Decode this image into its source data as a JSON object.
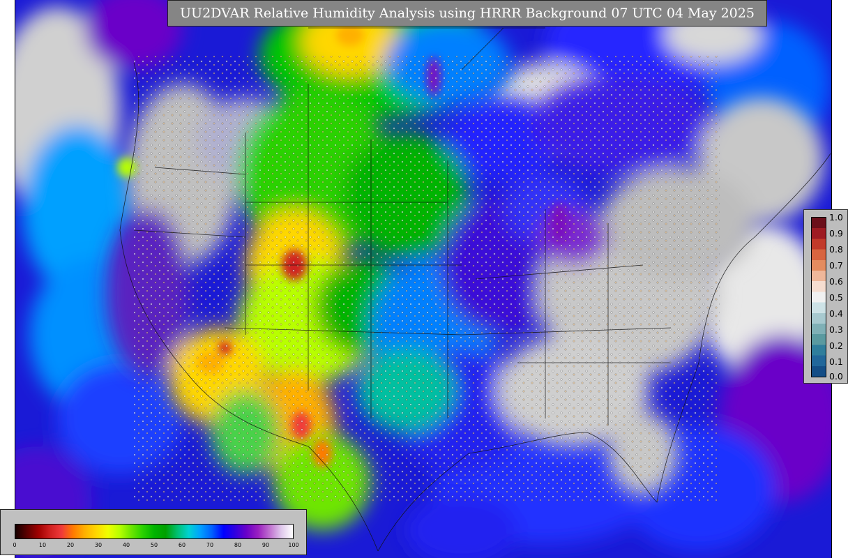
{
  "title": "UU2DVAR Relative Humidity Analysis using HRRR Background 07 UTC 04 May 2025",
  "legend_right": {
    "ticks": [
      "1.0",
      "0.9",
      "0.8",
      "0.7",
      "0.6",
      "0.5",
      "0.4",
      "0.3",
      "0.2",
      "0.1",
      "0.0"
    ],
    "colors": [
      "#6b0f1a",
      "#9e1b22",
      "#c23a2a",
      "#d8643f",
      "#e48c5f",
      "#efb79a",
      "#f6ddd0",
      "#f1f1f1",
      "#cde2e6",
      "#a7c9cf",
      "#7fb0b6",
      "#5a9aa0",
      "#2f7e9c",
      "#21679a",
      "#144e86"
    ]
  },
  "legend_bottom": {
    "ticks": [
      "0",
      "10",
      "20",
      "30",
      "40",
      "50",
      "60",
      "70",
      "80",
      "90",
      "100"
    ],
    "colors": [
      "#140000",
      "#5a0000",
      "#a00000",
      "#d02020",
      "#f03a3a",
      "#ff7a00",
      "#ffb000",
      "#ffd700",
      "#f0ff00",
      "#b8ff00",
      "#6ee600",
      "#2ad200",
      "#00b400",
      "#00a000",
      "#00c070",
      "#00d2d2",
      "#00a0ff",
      "#0060ff",
      "#0000ff",
      "#3000e0",
      "#6a00c8",
      "#9a20c0",
      "#c070d0",
      "#e0c8ec",
      "#ffffff"
    ]
  },
  "colors": {
    "map_ocean": "#1b1bd0",
    "land_gray": "#c8c8c8",
    "title_bg": "#858585",
    "legend_bg": "#bdbdbd"
  }
}
